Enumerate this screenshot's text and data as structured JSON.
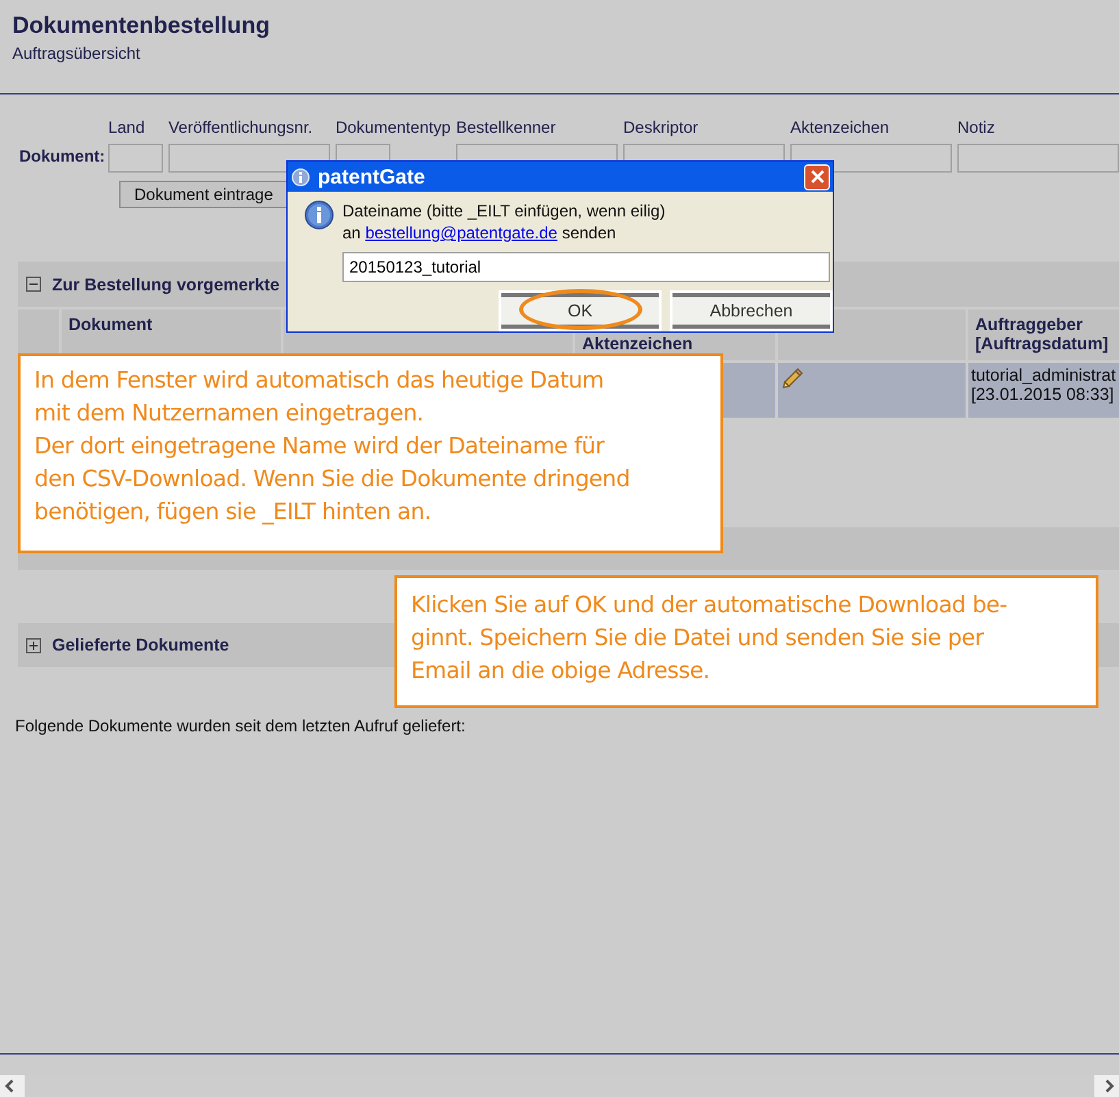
{
  "header": {
    "title": "Dokumentenbestellung",
    "subtitle": "Auftragsübersicht"
  },
  "form": {
    "label": "Dokument:",
    "fields": [
      {
        "label": "Land"
      },
      {
        "label": "Veröffentlichungsnr."
      },
      {
        "label": "Dokumententyp"
      },
      {
        "label": "Bestellkenner"
      },
      {
        "label": "Deskriptor"
      },
      {
        "label": "Aktenzeichen"
      },
      {
        "label": "Notiz"
      }
    ],
    "button": "Dokument eintrage"
  },
  "sections": [
    {
      "title": "Zur Bestellung vorgemerkte",
      "expanded": true
    },
    {
      "title": "Gelieferte Dokumente",
      "expanded": false
    }
  ],
  "table": {
    "columns": [
      "",
      "Dokument",
      "",
      "Aktenzeichen",
      "",
      "Auftraggeber [Auftragsdatum]"
    ],
    "rows": [
      {
        "cells": [
          "",
          "",
          "",
          "",
          "",
          "tutorial_administrat [23.01.2015 08:33]"
        ],
        "editable": true
      }
    ]
  },
  "note": "Folgende Dokumente wurden seit dem letzten Aufruf geliefert:",
  "dialog": {
    "title": "patentGate",
    "line1": "Dateiname (bitte _EILT einfügen, wenn eilig)",
    "line2_prefix": "an",
    "email": "bestellung@patentgate.de",
    "line2_suffix": "senden",
    "value": "20150123_tutorial",
    "buttons": [
      {
        "label": "OK",
        "highlighted": true
      },
      {
        "label": "Abbrechen",
        "highlighted": false
      }
    ]
  },
  "callouts": [
    {
      "lines": [
        "In dem Fenster wird automatisch das heutige Datum",
        "mit dem Nutzernamen eingetragen.",
        "Der dort eingetragene Name wird der Dateiname für",
        "den CSV-Download. Wenn Sie die Dokumente dringend",
        "benötigen, fügen sie _EILT hinten an."
      ]
    },
    {
      "lines": [
        "Klicken Sie auf OK und der automatische Download be-",
        "ginnt. Speichern Sie die Datei und senden Sie sie per",
        "Email an die obige Adresse."
      ]
    }
  ]
}
